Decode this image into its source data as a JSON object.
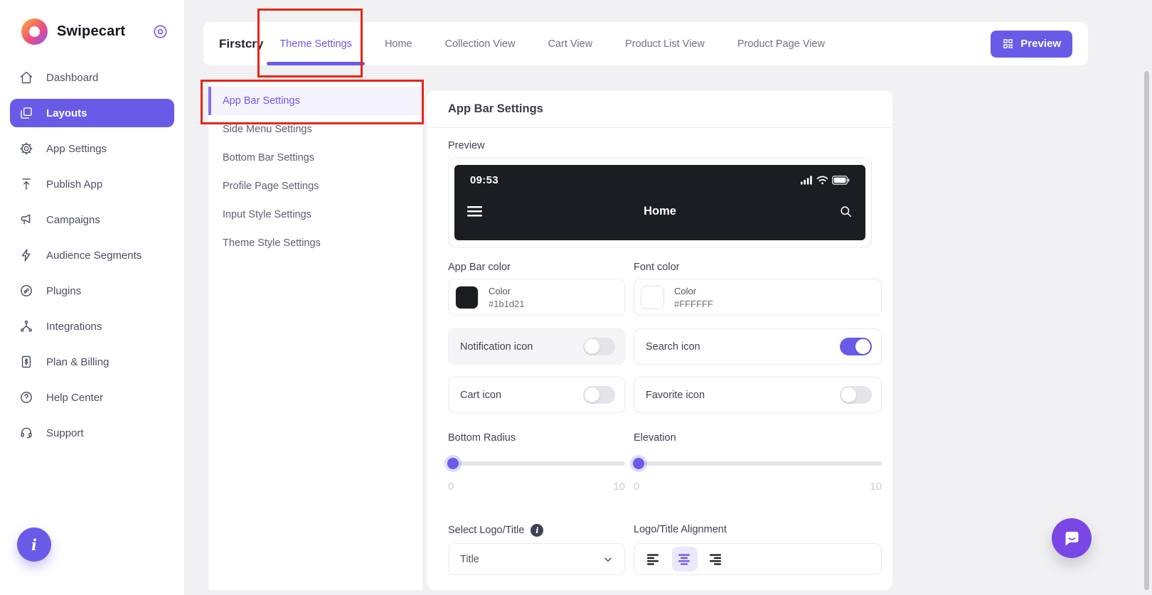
{
  "brand": {
    "name": "Swipecart"
  },
  "sidebar": {
    "items": [
      {
        "label": "Dashboard",
        "icon": "home-icon",
        "active": false
      },
      {
        "label": "Layouts",
        "icon": "layouts-icon",
        "active": true
      },
      {
        "label": "App Settings",
        "icon": "gear-icon",
        "active": false
      },
      {
        "label": "Publish App",
        "icon": "publish-icon",
        "active": false
      },
      {
        "label": "Campaigns",
        "icon": "megaphone-icon",
        "active": false
      },
      {
        "label": "Audience Segments",
        "icon": "lightning-icon",
        "active": false
      },
      {
        "label": "Plugins",
        "icon": "plugin-icon",
        "active": false
      },
      {
        "label": "Integrations",
        "icon": "integrations-icon",
        "active": false
      },
      {
        "label": "Plan & Billing",
        "icon": "billing-icon",
        "active": false
      },
      {
        "label": "Help Center",
        "icon": "help-icon",
        "active": false
      },
      {
        "label": "Support",
        "icon": "support-icon",
        "active": false
      }
    ],
    "info_fab_label": "i"
  },
  "topbar": {
    "store_name": "Firstcry",
    "tabs": [
      {
        "label": "Theme Settings",
        "active": true
      },
      {
        "label": "Home",
        "active": false
      },
      {
        "label": "Collection View",
        "active": false
      },
      {
        "label": "Cart View",
        "active": false
      },
      {
        "label": "Product List View",
        "active": false
      },
      {
        "label": "Product Page View",
        "active": false
      }
    ],
    "preview_label": "Preview"
  },
  "settings_menu": {
    "items": [
      {
        "label": "App Bar Settings",
        "active": true
      },
      {
        "label": "Side Menu Settings",
        "active": false
      },
      {
        "label": "Bottom Bar Settings",
        "active": false
      },
      {
        "label": "Profile Page Settings",
        "active": false
      },
      {
        "label": "Input Style Settings",
        "active": false
      },
      {
        "label": "Theme Style Settings",
        "active": false
      }
    ]
  },
  "panel": {
    "title": "App Bar Settings",
    "preview_label": "Preview",
    "phone_preview": {
      "time": "09:53",
      "title": "Home",
      "status_icons": [
        "signal-icon",
        "wifi-icon",
        "battery-icon"
      ],
      "left_icon": "hamburger-menu-icon",
      "right_icon": "search-icon"
    },
    "app_bar_color": {
      "label": "App Bar color",
      "name": "Color",
      "value": "#1b1d21"
    },
    "font_color": {
      "label": "Font color",
      "name": "Color",
      "value": "#FFFFFF"
    },
    "toggles": [
      {
        "label": "Notification icon",
        "on": false,
        "muted": true
      },
      {
        "label": "Search icon",
        "on": true,
        "muted": false
      },
      {
        "label": "Cart icon",
        "on": false,
        "muted": false
      },
      {
        "label": "Favorite icon",
        "on": false,
        "muted": false
      }
    ],
    "sliders": [
      {
        "label": "Bottom Radius",
        "min": "0",
        "max": "10",
        "value": 0
      },
      {
        "label": "Elevation",
        "min": "0",
        "max": "10",
        "value": 0
      }
    ],
    "logo_title": {
      "label": "Select Logo/Title",
      "selected": "Title",
      "info_badge": "i"
    },
    "alignment": {
      "label": "Logo/Title Alignment",
      "options": [
        "align-left",
        "align-center",
        "align-right"
      ],
      "selected_option": "align-center",
      "center_selected": true
    }
  },
  "colors": {
    "accent": "#6a5ae8",
    "app_bar_black": "#1b1d21",
    "annotation_red": "#e42617",
    "selected_align_bg": "#ece8fb"
  }
}
